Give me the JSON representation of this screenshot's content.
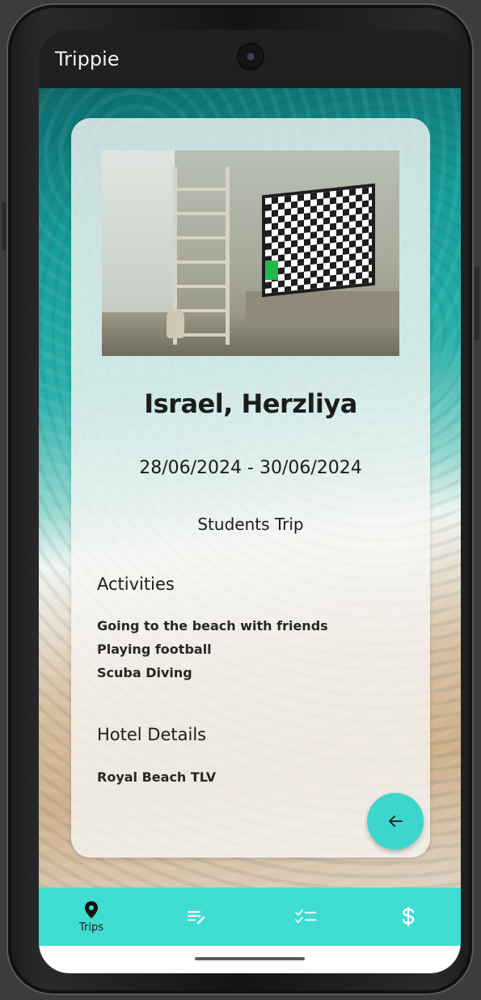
{
  "app": {
    "title": "Trippie"
  },
  "trip": {
    "destination": "Israel, Herzliya",
    "dates": "28/06/2024 - 30/06/2024",
    "type": "Students Trip",
    "activities_heading": "Activities",
    "activities": [
      "Going to the beach with friends",
      "Playing football",
      "Scuba Diving"
    ],
    "hotel_heading": "Hotel Details",
    "hotel": "Royal Beach TLV"
  },
  "fab": {
    "icon": "arrow-left-icon"
  },
  "bottom_nav": {
    "items": [
      {
        "label": "Trips",
        "icon": "location-pin-icon",
        "active": true
      },
      {
        "label": "",
        "icon": "edit-list-icon"
      },
      {
        "label": "",
        "icon": "checklist-icon"
      },
      {
        "label": "",
        "icon": "dollar-icon"
      }
    ]
  },
  "colors": {
    "accent": "#3fdcd2",
    "fab": "#3dd6cc",
    "status_bar": "#202020"
  }
}
